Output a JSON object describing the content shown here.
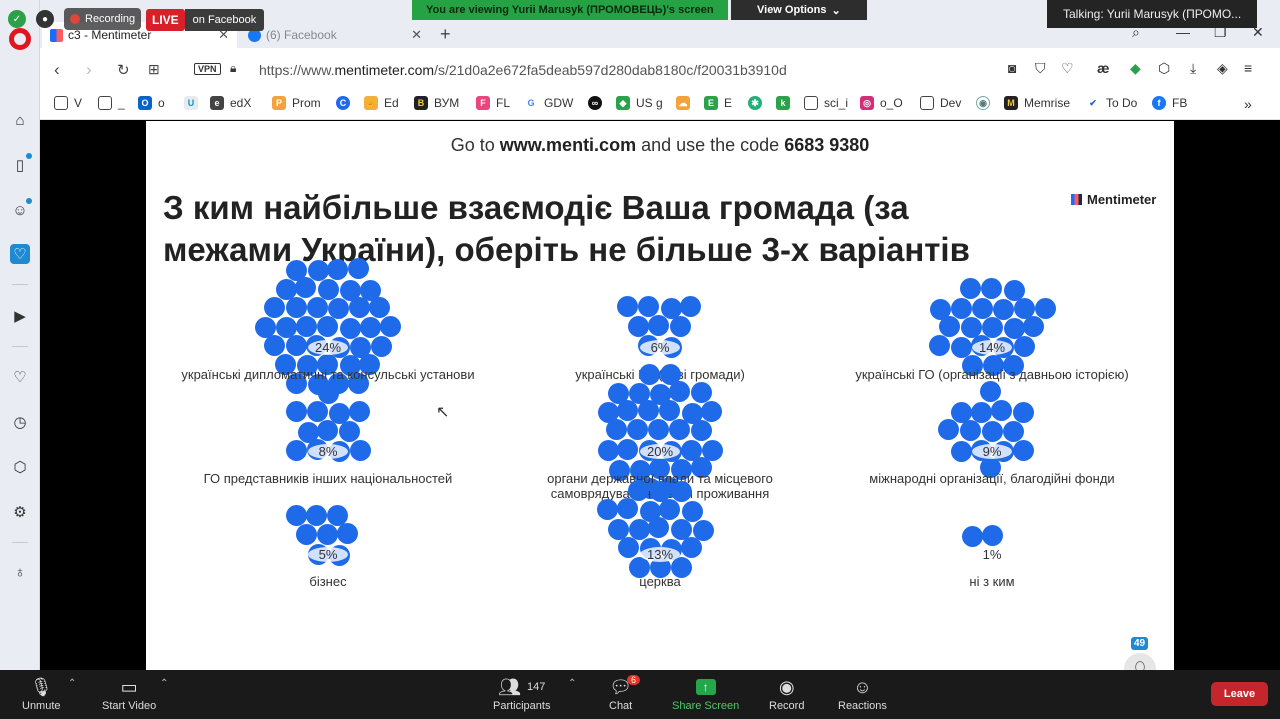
{
  "meeting": {
    "recording_label": "Recording",
    "live_badge": "LIVE",
    "live_target": "on Facebook",
    "viewing_banner": "You are viewing Yurii Marusyk (ПРОМОВЕЦЬ)'s screen",
    "view_options": "View Options",
    "talking": "Talking: Yurii Marusyk (ПРОМО..."
  },
  "browser": {
    "tabs": [
      {
        "label": "c3 - Mentimeter",
        "active": true
      },
      {
        "label": "(6) Facebook",
        "active": false
      }
    ],
    "url_prefix": "https://www.",
    "url_domain": "mentimeter.com",
    "url_path": "/s/21d0a2e672fa5deab597d280dab8180c/f20031b3910d",
    "vpn_label": "VPN",
    "bookmarks": [
      "V",
      "_",
      "o",
      "edX",
      "Prom",
      "Ed",
      "ВУМ",
      "FL",
      "GDW",
      "US g",
      "E",
      "sci_i",
      "o_O",
      "Dev",
      "Memrise",
      "To Do",
      "FB"
    ]
  },
  "slide": {
    "goto_prefix": "Go to ",
    "goto_url": "www.menti.com",
    "goto_mid": " and use the code ",
    "goto_code": "6683 9380",
    "question": "З ким найбільше взаємодіє Ваша громада (за межами України), оберіть не більше 3-х варіантів",
    "brand": "Mentimeter",
    "participant_count": "49",
    "options": [
      {
        "label": "українські дипломатичні та консульські установи",
        "percent": "24%"
      },
      {
        "label": "українські ГО (нові громади)",
        "percent": "6%"
      },
      {
        "label": "українські ГО (організації з давньою історією)",
        "percent": "14%"
      },
      {
        "label": "ГО представників інших національностей",
        "percent": "8%"
      },
      {
        "label": "органи державної влади та місцевого самоврядування країни проживання",
        "percent": "20%"
      },
      {
        "label": "міжнародні організації, благодійні фонди",
        "percent": "9%"
      },
      {
        "label": "бізнес",
        "percent": "5%"
      },
      {
        "label": "церква",
        "percent": "13%"
      },
      {
        "label": "ні з ким",
        "percent": "1%"
      }
    ]
  },
  "toolbar": {
    "unmute": "Unmute",
    "start_video": "Start Video",
    "participants": "Participants",
    "participants_count": "147",
    "chat": "Chat",
    "chat_badge": "6",
    "share_screen": "Share Screen",
    "record": "Record",
    "reactions": "Reactions",
    "leave": "Leave"
  },
  "colors": {
    "bubble": "#1f6ae8",
    "live": "#d8202a",
    "viewing_banner": "#25a244",
    "leave": "#c5262c"
  }
}
